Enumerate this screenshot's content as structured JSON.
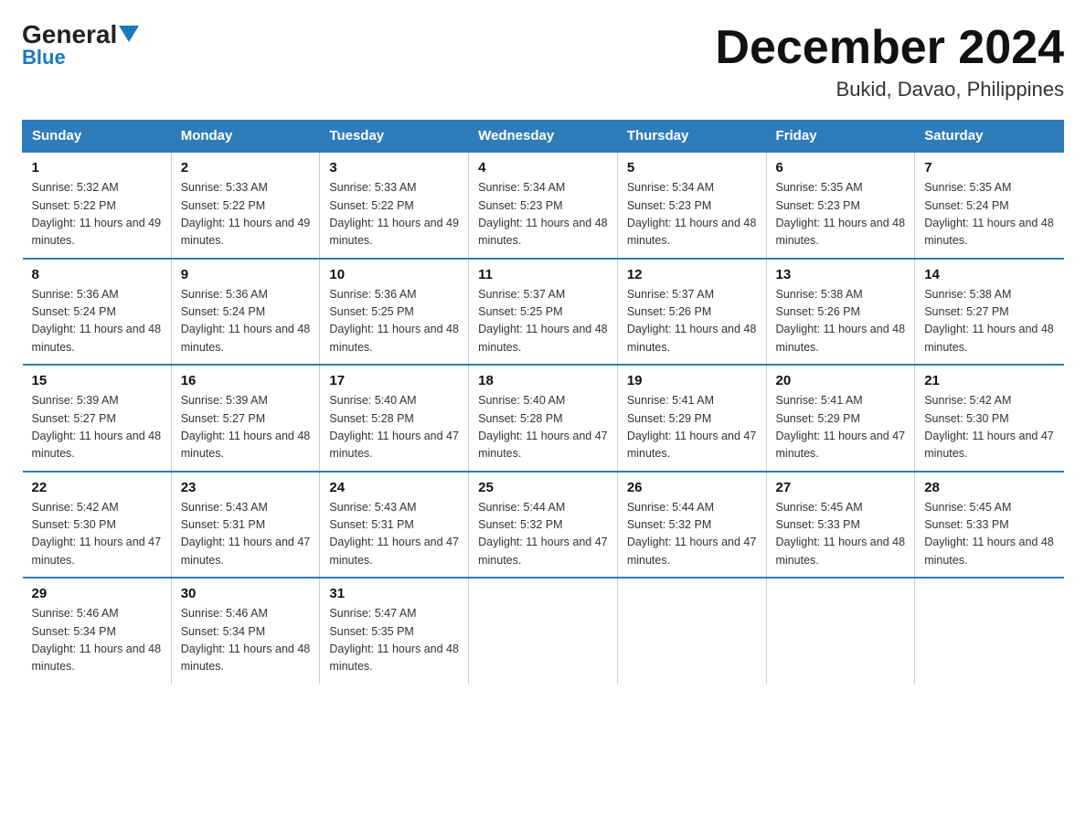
{
  "header": {
    "logo_main": "General",
    "logo_sub": "Blue",
    "month_title": "December 2024",
    "location": "Bukid, Davao, Philippines"
  },
  "days_of_week": [
    "Sunday",
    "Monday",
    "Tuesday",
    "Wednesday",
    "Thursday",
    "Friday",
    "Saturday"
  ],
  "weeks": [
    [
      {
        "day": "1",
        "sunrise": "Sunrise: 5:32 AM",
        "sunset": "Sunset: 5:22 PM",
        "daylight": "Daylight: 11 hours and 49 minutes."
      },
      {
        "day": "2",
        "sunrise": "Sunrise: 5:33 AM",
        "sunset": "Sunset: 5:22 PM",
        "daylight": "Daylight: 11 hours and 49 minutes."
      },
      {
        "day": "3",
        "sunrise": "Sunrise: 5:33 AM",
        "sunset": "Sunset: 5:22 PM",
        "daylight": "Daylight: 11 hours and 49 minutes."
      },
      {
        "day": "4",
        "sunrise": "Sunrise: 5:34 AM",
        "sunset": "Sunset: 5:23 PM",
        "daylight": "Daylight: 11 hours and 48 minutes."
      },
      {
        "day": "5",
        "sunrise": "Sunrise: 5:34 AM",
        "sunset": "Sunset: 5:23 PM",
        "daylight": "Daylight: 11 hours and 48 minutes."
      },
      {
        "day": "6",
        "sunrise": "Sunrise: 5:35 AM",
        "sunset": "Sunset: 5:23 PM",
        "daylight": "Daylight: 11 hours and 48 minutes."
      },
      {
        "day": "7",
        "sunrise": "Sunrise: 5:35 AM",
        "sunset": "Sunset: 5:24 PM",
        "daylight": "Daylight: 11 hours and 48 minutes."
      }
    ],
    [
      {
        "day": "8",
        "sunrise": "Sunrise: 5:36 AM",
        "sunset": "Sunset: 5:24 PM",
        "daylight": "Daylight: 11 hours and 48 minutes."
      },
      {
        "day": "9",
        "sunrise": "Sunrise: 5:36 AM",
        "sunset": "Sunset: 5:24 PM",
        "daylight": "Daylight: 11 hours and 48 minutes."
      },
      {
        "day": "10",
        "sunrise": "Sunrise: 5:36 AM",
        "sunset": "Sunset: 5:25 PM",
        "daylight": "Daylight: 11 hours and 48 minutes."
      },
      {
        "day": "11",
        "sunrise": "Sunrise: 5:37 AM",
        "sunset": "Sunset: 5:25 PM",
        "daylight": "Daylight: 11 hours and 48 minutes."
      },
      {
        "day": "12",
        "sunrise": "Sunrise: 5:37 AM",
        "sunset": "Sunset: 5:26 PM",
        "daylight": "Daylight: 11 hours and 48 minutes."
      },
      {
        "day": "13",
        "sunrise": "Sunrise: 5:38 AM",
        "sunset": "Sunset: 5:26 PM",
        "daylight": "Daylight: 11 hours and 48 minutes."
      },
      {
        "day": "14",
        "sunrise": "Sunrise: 5:38 AM",
        "sunset": "Sunset: 5:27 PM",
        "daylight": "Daylight: 11 hours and 48 minutes."
      }
    ],
    [
      {
        "day": "15",
        "sunrise": "Sunrise: 5:39 AM",
        "sunset": "Sunset: 5:27 PM",
        "daylight": "Daylight: 11 hours and 48 minutes."
      },
      {
        "day": "16",
        "sunrise": "Sunrise: 5:39 AM",
        "sunset": "Sunset: 5:27 PM",
        "daylight": "Daylight: 11 hours and 48 minutes."
      },
      {
        "day": "17",
        "sunrise": "Sunrise: 5:40 AM",
        "sunset": "Sunset: 5:28 PM",
        "daylight": "Daylight: 11 hours and 47 minutes."
      },
      {
        "day": "18",
        "sunrise": "Sunrise: 5:40 AM",
        "sunset": "Sunset: 5:28 PM",
        "daylight": "Daylight: 11 hours and 47 minutes."
      },
      {
        "day": "19",
        "sunrise": "Sunrise: 5:41 AM",
        "sunset": "Sunset: 5:29 PM",
        "daylight": "Daylight: 11 hours and 47 minutes."
      },
      {
        "day": "20",
        "sunrise": "Sunrise: 5:41 AM",
        "sunset": "Sunset: 5:29 PM",
        "daylight": "Daylight: 11 hours and 47 minutes."
      },
      {
        "day": "21",
        "sunrise": "Sunrise: 5:42 AM",
        "sunset": "Sunset: 5:30 PM",
        "daylight": "Daylight: 11 hours and 47 minutes."
      }
    ],
    [
      {
        "day": "22",
        "sunrise": "Sunrise: 5:42 AM",
        "sunset": "Sunset: 5:30 PM",
        "daylight": "Daylight: 11 hours and 47 minutes."
      },
      {
        "day": "23",
        "sunrise": "Sunrise: 5:43 AM",
        "sunset": "Sunset: 5:31 PM",
        "daylight": "Daylight: 11 hours and 47 minutes."
      },
      {
        "day": "24",
        "sunrise": "Sunrise: 5:43 AM",
        "sunset": "Sunset: 5:31 PM",
        "daylight": "Daylight: 11 hours and 47 minutes."
      },
      {
        "day": "25",
        "sunrise": "Sunrise: 5:44 AM",
        "sunset": "Sunset: 5:32 PM",
        "daylight": "Daylight: 11 hours and 47 minutes."
      },
      {
        "day": "26",
        "sunrise": "Sunrise: 5:44 AM",
        "sunset": "Sunset: 5:32 PM",
        "daylight": "Daylight: 11 hours and 47 minutes."
      },
      {
        "day": "27",
        "sunrise": "Sunrise: 5:45 AM",
        "sunset": "Sunset: 5:33 PM",
        "daylight": "Daylight: 11 hours and 48 minutes."
      },
      {
        "day": "28",
        "sunrise": "Sunrise: 5:45 AM",
        "sunset": "Sunset: 5:33 PM",
        "daylight": "Daylight: 11 hours and 48 minutes."
      }
    ],
    [
      {
        "day": "29",
        "sunrise": "Sunrise: 5:46 AM",
        "sunset": "Sunset: 5:34 PM",
        "daylight": "Daylight: 11 hours and 48 minutes."
      },
      {
        "day": "30",
        "sunrise": "Sunrise: 5:46 AM",
        "sunset": "Sunset: 5:34 PM",
        "daylight": "Daylight: 11 hours and 48 minutes."
      },
      {
        "day": "31",
        "sunrise": "Sunrise: 5:47 AM",
        "sunset": "Sunset: 5:35 PM",
        "daylight": "Daylight: 11 hours and 48 minutes."
      },
      {
        "day": "",
        "sunrise": "",
        "sunset": "",
        "daylight": ""
      },
      {
        "day": "",
        "sunrise": "",
        "sunset": "",
        "daylight": ""
      },
      {
        "day": "",
        "sunrise": "",
        "sunset": "",
        "daylight": ""
      },
      {
        "day": "",
        "sunrise": "",
        "sunset": "",
        "daylight": ""
      }
    ]
  ]
}
